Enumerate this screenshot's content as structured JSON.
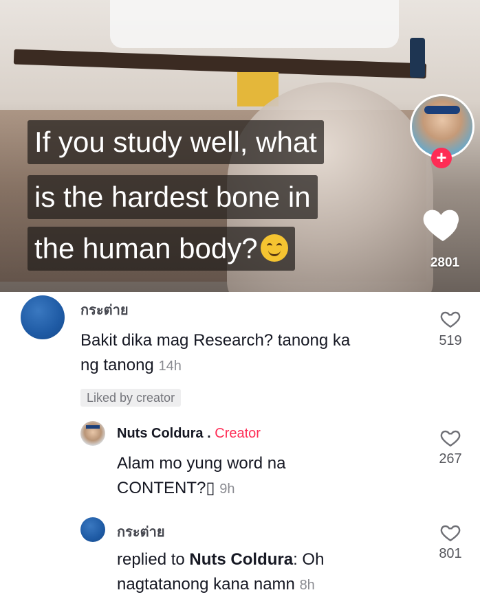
{
  "video": {
    "caption_lines": [
      "If you study well, what",
      "is the hardest bone in",
      "the human body?"
    ],
    "like_count": "2801",
    "follow_icon": "plus-icon"
  },
  "comments": [
    {
      "username": "กระต่าย",
      "text": "Bakit dika mag Research? tanong ka",
      "text_line2": "ng tanong",
      "time": "14h",
      "likes": "519",
      "badge": "Liked by creator"
    }
  ],
  "replies": [
    {
      "username": "Nuts Coldura",
      "separator": ".",
      "tag": "Creator",
      "text": "Alam mo yung word na",
      "text_line2": "CONTENT?▯",
      "time": "9h",
      "likes": "267"
    },
    {
      "username": "กระต่าย",
      "replied_prefix": "replied to",
      "replied_to": "Nuts Coldura",
      "replied_suffix": ": Oh",
      "text_line2": "nagtatanong kana namn",
      "time": "8h",
      "likes": "801"
    }
  ],
  "colors": {
    "accent": "#fe2c55",
    "avatar_blue": "#1e5aa4",
    "text": "#161823",
    "muted": "#8a8b91"
  }
}
